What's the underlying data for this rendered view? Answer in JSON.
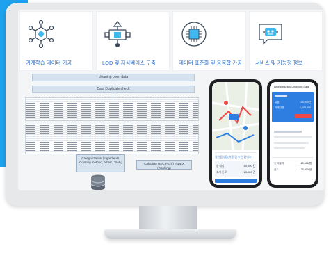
{
  "cards": [
    {
      "icon": "network-nodes-icon",
      "label": "기계학습 데이터 기공"
    },
    {
      "icon": "database-flow-icon",
      "label": "LOD 및 지식베이스 구축"
    },
    {
      "icon": "chip-icon",
      "label": "데이터 표준화 및 융복합 가공"
    },
    {
      "icon": "robot-chat-icon",
      "label": "서비스 및 지능형 정보"
    }
  ],
  "diagram": {
    "step1": "cleaning open data",
    "step2": "Data Duplicate check",
    "category_box": "Categorization (Ingredients, Cooking method, ethnic, Tasty)",
    "calc_box": "Calculate RECIPE(S) INDEX (Ranking)"
  },
  "phone_left": {
    "card_title": "일반음식점(아동 및 노인 급식소)",
    "rows": [
      {
        "k": "총 대상",
        "v": "150,000 건"
      },
      {
        "k": "조사 완료",
        "v": "25,000 건"
      }
    ]
  },
  "phone_right": {
    "header": "Aeonsong&soo Cookbook Data",
    "rows": [
      {
        "k": "유효",
        "v": "100,000건"
      },
      {
        "k": "거래처명",
        "v": "1,234,000"
      }
    ],
    "footer_rows": [
      {
        "k": "총 매출액",
        "v": "123,456 원"
      },
      {
        "k": "건수",
        "v": "125,000 건"
      }
    ]
  },
  "colors": {
    "accent": "#1ea2ee",
    "label": "#2a6fd0"
  }
}
